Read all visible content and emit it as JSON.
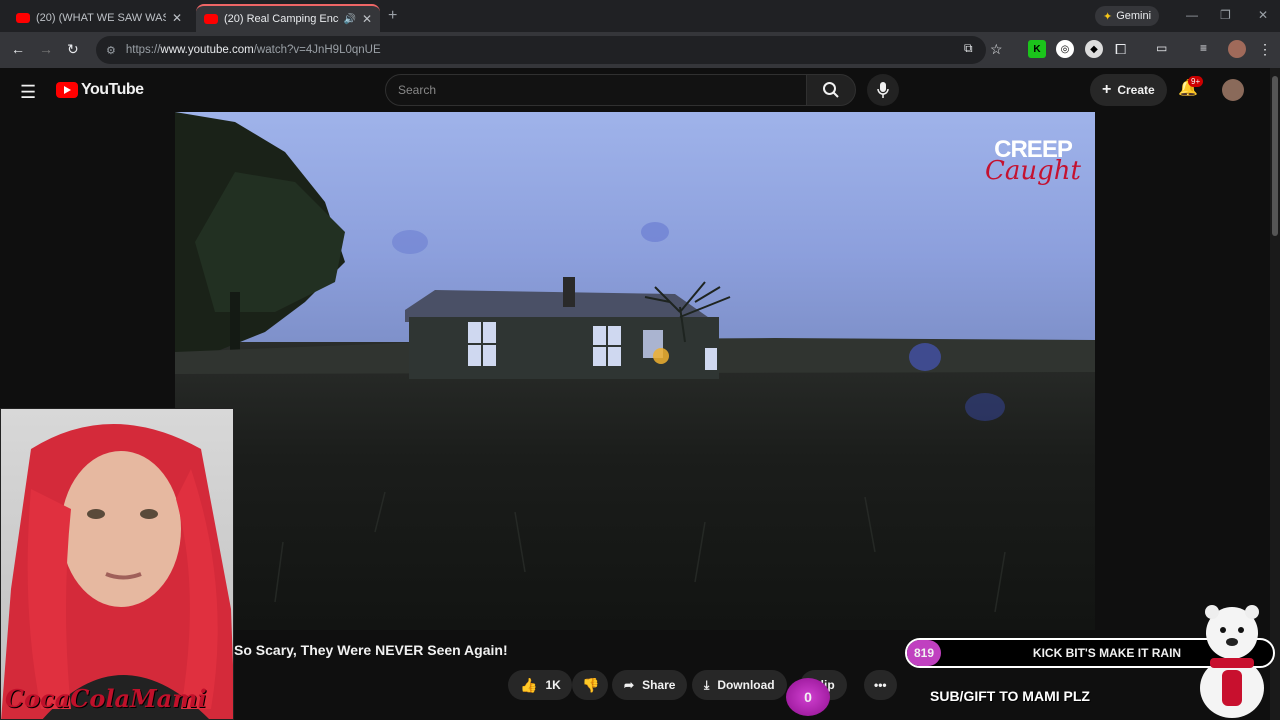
{
  "browser": {
    "tabs": [
      {
        "title": "(20) (WHAT WE SAW WAS TERI",
        "active": false
      },
      {
        "title": "(20) Real Camping Encount",
        "active": true
      }
    ],
    "url_prefix": "https://",
    "url_site": "www.youtube.com",
    "url_path": "/watch?v=4JnH9L0qnUE",
    "gemini_label": "Gemini"
  },
  "youtube": {
    "logo_text": "YouTube",
    "search_placeholder": "Search",
    "create_label": "Create",
    "notification_badge": "9+"
  },
  "video": {
    "watermark_line1": "CREEP",
    "watermark_line2": "Caught",
    "title": "So Scary, They Were NEVER Seen Again!",
    "likes": "1K",
    "share_label": "Share",
    "download_label": "Download",
    "clip_label": "Clip"
  },
  "stream_overlay": {
    "webcam_name": "CocaColaMami",
    "bits_count": "819",
    "bits_text": "KICK BIT'S MAKE IT RAIN",
    "sub_counter": "0",
    "sub_text": "SUB/GIFT TO MAMI PLZ"
  }
}
